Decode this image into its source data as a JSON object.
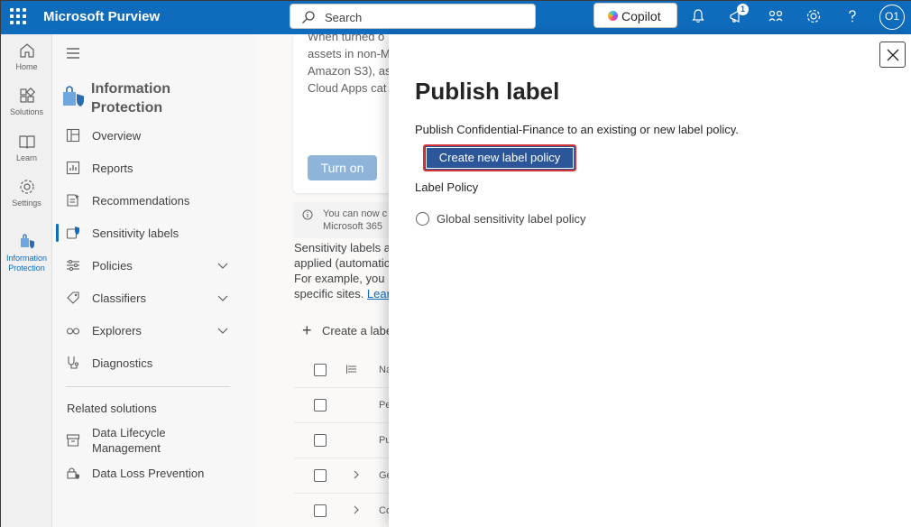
{
  "topbar": {
    "app_title": "Microsoft Purview",
    "search_placeholder": "Search",
    "copilot_label": "Copilot",
    "notification_count": "1",
    "user_initials": "O1"
  },
  "rail": {
    "items": [
      {
        "label": "Home",
        "icon": "home-icon"
      },
      {
        "label": "Solutions",
        "icon": "solutions-icon"
      },
      {
        "label": "Learn",
        "icon": "learn-icon"
      },
      {
        "label": "Settings",
        "icon": "settings-icon"
      },
      {
        "label": "Information Protection",
        "icon": "information-protection-icon",
        "active": true
      }
    ]
  },
  "nav": {
    "title": "Information Protection",
    "items": [
      {
        "label": "Overview",
        "icon": "overview-icon"
      },
      {
        "label": "Reports",
        "icon": "reports-icon"
      },
      {
        "label": "Recommendations",
        "icon": "recommendations-icon"
      },
      {
        "label": "Sensitivity labels",
        "icon": "sensitivity-labels-icon",
        "selected": true
      },
      {
        "label": "Policies",
        "icon": "policies-icon",
        "expandable": true
      },
      {
        "label": "Classifiers",
        "icon": "classifiers-icon",
        "expandable": true
      },
      {
        "label": "Explorers",
        "icon": "explorers-icon",
        "expandable": true
      },
      {
        "label": "Diagnostics",
        "icon": "diagnostics-icon"
      }
    ],
    "related_heading": "Related solutions",
    "related_items": [
      {
        "label": "Data Lifecycle Management",
        "icon": "data-lifecycle-icon"
      },
      {
        "label": "Data Loss Prevention",
        "icon": "data-loss-prevention-icon"
      }
    ]
  },
  "background": {
    "card_lines": [
      "When turned o",
      "assets in non-M",
      "Amazon S3), as",
      "Cloud Apps cat"
    ],
    "turn_on_label": "Turn on",
    "info_line1": "You can now c",
    "info_line2": "Microsoft 365",
    "desc_lines": [
      "Sensitivity labels a",
      "applied (automatic",
      "For example, you",
      "specific sites. "
    ],
    "desc_link": "Lear",
    "create_label": "Create a label",
    "table_header": "Na",
    "rows": [
      "Pe",
      "Pu",
      "Ge",
      "Co"
    ]
  },
  "panel": {
    "title": "Publish label",
    "description": "Publish Confidential-Finance to an existing or new label policy.",
    "create_button_label": "Create new label policy",
    "label_policy_heading": "Label Policy",
    "policy_options": [
      "Global sensitivity label policy"
    ]
  },
  "colors": {
    "topbar": "#0f6cbd",
    "primary_button": "#2b579a",
    "highlight_border": "#d13438"
  }
}
